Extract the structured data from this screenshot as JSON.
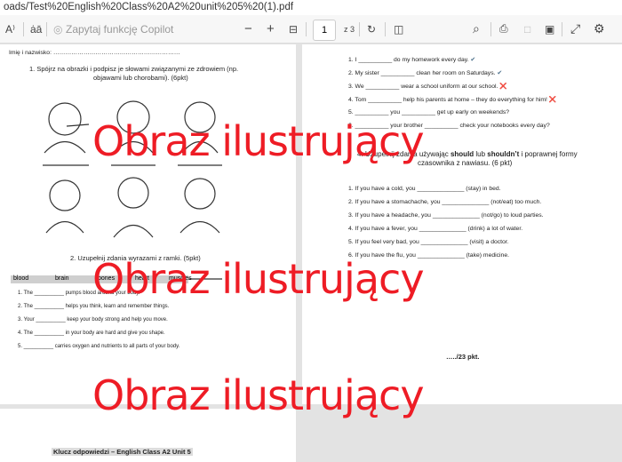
{
  "address": "oads/Test%20English%20Class%20A2%20unit%205%20(1).pdf",
  "toolbar": {
    "read_aloud": "A⁾",
    "translate": "ȧā",
    "copilot_placeholder": "Zapytaj funkcję Copilot",
    "zoom_out": "−",
    "zoom_in": "+",
    "fit": "⊟",
    "page": "1",
    "page_total": "z 3",
    "rotate": "↻",
    "view": "◫",
    "search": "⌕",
    "print": "⎙",
    "save": "□",
    "save_as": "▣",
    "fullscreen": "⤢",
    "settings": "⚙"
  },
  "left": {
    "name_line": "Imię i nazwisko: ………………………………………………………",
    "task1_line1": "1.  Spójrz na obrazki i podpisz je słowami związanymi ze zdrowiem (np.",
    "task1_line2": "objawami lub chorobami). (6pkt)",
    "task2_title": "2.  Uzupełnij zdania wyrazami z ramki. (5pkt)",
    "words": [
      "blood",
      "brain",
      "bones",
      "heart",
      "muscles"
    ],
    "task2_items": [
      "1.   The __________ pumps blood around your body.",
      "2.   The __________ helps you think, learn and remember things.",
      "3.   Your __________ keep your body strong and help you move.",
      "4.   The __________ in your body are hard and give you shape.",
      "5.   __________ carries oxygen and nutrients to all parts of your body."
    ],
    "answer_key": "Klucz odpowiedzi – English Class A2 Unit 5"
  },
  "right": {
    "task3_items": [
      {
        "text": "1.   I __________ do my homework every day.",
        "mark": "✔"
      },
      {
        "text": "2.   My sister __________ clean her room on Saturdays.",
        "mark": "✔"
      },
      {
        "text": "3.   We __________ wear a school uniform at our school.",
        "mark": "❌"
      },
      {
        "text": "4.   Tom __________ help his parents at home – they do everything for him!",
        "mark": "❌"
      },
      {
        "text": "5.   __________ you __________ get up early on weekends?",
        "mark": ""
      },
      {
        "text": "6.   __________ your brother __________ check your notebooks every day?",
        "mark": ""
      }
    ],
    "task4_line1_a": "4. Uzupełnij zdania używając ",
    "task4_should": "should",
    "task4_or": " lub ",
    "task4_shouldnt": "shouldn’t",
    "task4_line1_b": " i poprawnej formy",
    "task4_line2": "czasownika z nawiasu. (6 pkt)",
    "task4_items": [
      "1.   If you have a cold, you ______________ (stay) in bed.",
      "2.   If you have a stomachache, you ______________ (not/eat) too much.",
      "3.   If you have a headache, you ______________ (not/go) to loud parties.",
      "4.   If you have a fever, you ______________ (drink) a lot of water.",
      "5.   If you feel very bad, you  ______________ (visit) a doctor.",
      "6.   If you have the flu, you ______________ (take) medicine."
    ],
    "score": "…../23 pkt."
  },
  "watermark": "Obraz ilustrujący",
  "colors": {
    "watermark": "#ee1c25",
    "check": "#4a6f8a",
    "cross": "#e53935"
  }
}
